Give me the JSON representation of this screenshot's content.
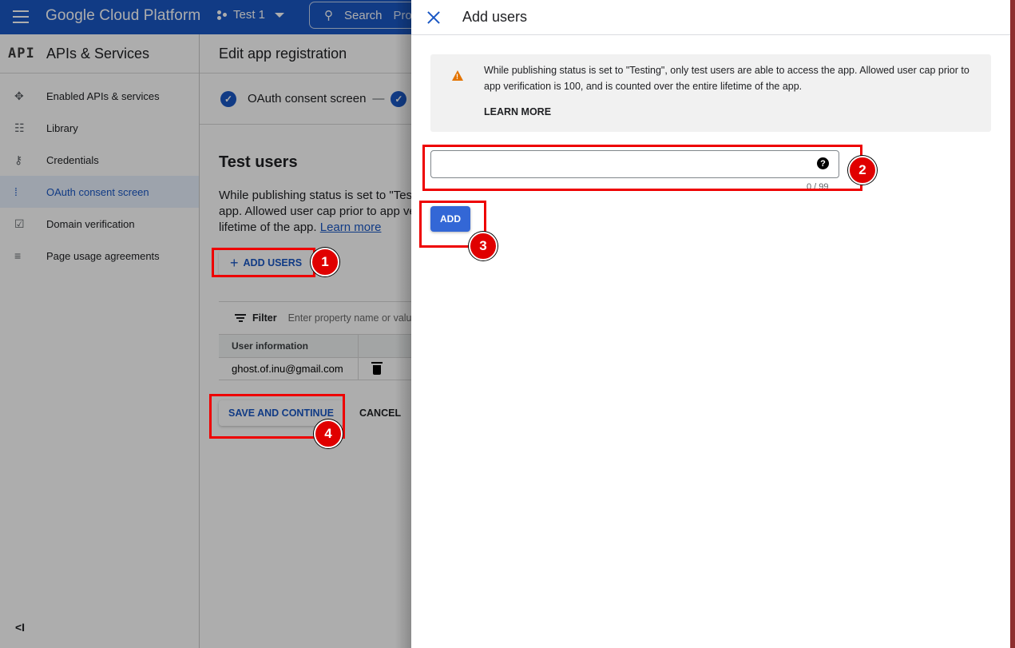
{
  "topbar": {
    "brand": "Google Cloud Platform",
    "project": "Test 1",
    "search_label": "Search",
    "search_suffix": "Pro"
  },
  "sidebar": {
    "logo": "API",
    "title": "APIs & Services",
    "items": [
      {
        "icon": "enabled-apis-icon",
        "glyph": "✥",
        "label": "Enabled APIs & services",
        "active": false
      },
      {
        "icon": "library-icon",
        "glyph": "☷",
        "label": "Library",
        "active": false
      },
      {
        "icon": "key-icon",
        "glyph": "⚷",
        "label": "Credentials",
        "active": false
      },
      {
        "icon": "consent-icon",
        "glyph": "⁞",
        "label": "OAuth consent screen",
        "active": true
      },
      {
        "icon": "domain-check-icon",
        "glyph": "☑",
        "label": "Domain verification",
        "active": false
      },
      {
        "icon": "page-settings-icon",
        "glyph": "≡",
        "label": "Page usage agreements",
        "active": false
      }
    ],
    "collapse_glyph": "<I"
  },
  "main": {
    "header": "Edit app registration",
    "step_label": "OAuth consent screen",
    "step_dash": "—",
    "section_title": "Test users",
    "description": "While publishing status is set to \"Testing\", only test users are able to access the app. Allowed user cap prior to app verification is 100, and is counted over the entire lifetime of the app.",
    "learn_link": "Learn more",
    "add_users_label": "ADD USERS",
    "filter_label": "Filter",
    "filter_placeholder": "Enter property name or value",
    "table": {
      "columns": [
        "User information",
        ""
      ],
      "rows": [
        {
          "email": "ghost.of.inu@gmail.com"
        }
      ]
    },
    "save_label": "SAVE AND CONTINUE",
    "cancel_label": "CANCEL"
  },
  "drawer": {
    "title": "Add users",
    "notice_text": "While publishing status is set to \"Testing\", only test users are able to access the app. Allowed user cap prior to app verification is 100, and is counted over the entire lifetime of the app.",
    "learn_more": "LEARN MORE",
    "input_value": "",
    "input_placeholder": "",
    "help_glyph": "?",
    "counter": "0 / 99",
    "add_label": "ADD"
  },
  "annotations": [
    {
      "number": "1",
      "target": "add-users-button"
    },
    {
      "number": "2",
      "target": "email-input"
    },
    {
      "number": "3",
      "target": "add-button"
    },
    {
      "number": "4",
      "target": "save-and-continue-button"
    }
  ],
  "colors": {
    "brand_blue": "#1a57c4",
    "primary_button": "#3367d6",
    "warning": "#e37400",
    "annotation_red": "#e00000"
  }
}
